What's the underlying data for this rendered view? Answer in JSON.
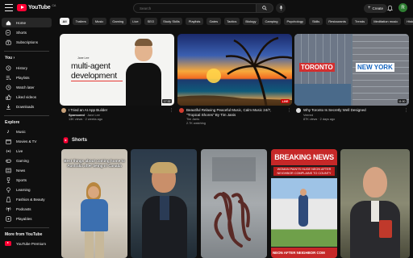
{
  "header": {
    "logo_text": "YouTube",
    "logo_country": "CA",
    "search_placeholder": "Search",
    "create_label": "Create",
    "avatar_initial": "R"
  },
  "sidebar": {
    "main": [
      {
        "label": "Home",
        "icon": "home-icon",
        "active": true
      },
      {
        "label": "Shorts",
        "icon": "shorts-icon"
      },
      {
        "label": "Subscriptions",
        "icon": "subscriptions-icon"
      }
    ],
    "you_heading": "You",
    "you_items": [
      {
        "label": "History",
        "icon": "history-icon"
      },
      {
        "label": "Playlists",
        "icon": "playlists-icon"
      },
      {
        "label": "Watch later",
        "icon": "watch-later-icon"
      },
      {
        "label": "Liked videos",
        "icon": "like-icon"
      },
      {
        "label": "Downloads",
        "icon": "download-icon"
      }
    ],
    "explore_heading": "Explore",
    "explore_items": [
      {
        "label": "Music",
        "icon": "music-icon"
      },
      {
        "label": "Movies & TV",
        "icon": "movies-icon"
      },
      {
        "label": "Live",
        "icon": "live-icon"
      },
      {
        "label": "Gaming",
        "icon": "gaming-icon"
      },
      {
        "label": "News",
        "icon": "news-icon"
      },
      {
        "label": "Sports",
        "icon": "sports-icon"
      },
      {
        "label": "Learning",
        "icon": "learning-icon"
      },
      {
        "label": "Fashion & Beauty",
        "icon": "fashion-icon"
      },
      {
        "label": "Podcasts",
        "icon": "podcasts-icon"
      },
      {
        "label": "Playables",
        "icon": "playables-icon"
      }
    ],
    "more_heading": "More from YouTube",
    "more_items": [
      {
        "label": "YouTube Premium",
        "icon": "youtube-premium-icon"
      }
    ]
  },
  "chips": [
    "All",
    "Trailers",
    "Music",
    "Gaming",
    "Live",
    "SEO",
    "Study Skills",
    "Playlists",
    "Gates",
    "Tactics",
    "Biology",
    "Camping",
    "Psychology",
    "Skills",
    "Restaurants",
    "Trends",
    "Meditation music",
    "Histo"
  ],
  "videos": [
    {
      "thumb_text": "multi-agent development",
      "thumb_small": "Jane Lee",
      "duration": "17:32",
      "title": "I Tried an AI App Builder",
      "badge": "Sponsored",
      "channel": "Jane Lee",
      "stats": "13K views · 2 weeks ago",
      "avatar_color": "#c9a27a"
    },
    {
      "duration": "10:40",
      "title": "Beautiful Relaxing Peaceful Music, Calm Music 24/7,",
      "title2": "\"Tropical Shores\" By Tim Janis",
      "channel": "Tim Janis",
      "stats": "2.7K watching",
      "live": "LIVE",
      "avatar_color": "#d23b2e"
    },
    {
      "thumb_left": "TORONTO",
      "thumb_right": "NEW YORK",
      "duration": "11:00",
      "title": "Why Toronto Is Secretly Well Designed",
      "channel": "Veered",
      "stats": "87K views · 2 days ago",
      "avatar_color": "#e0e0e0"
    }
  ],
  "shorts_heading": "Shorts",
  "shorts": [
    {
      "caption": "Best things about coming home to Australia after being in Canada"
    },
    {
      "caption": ""
    },
    {
      "caption": ""
    },
    {
      "caption_top": "BREAKING NEWS",
      "caption_mid": "WOMAN PAINTS HUGE NEON AFTER NEIGHBOR COMPLAINS TO COUNTY",
      "caption_bot": "NEON AFTER NEIGHBOR COM"
    },
    {
      "caption": ""
    }
  ],
  "colors": {
    "accent_red": "#ff0033",
    "background": "#0f0f0f",
    "chip": "#272727"
  }
}
